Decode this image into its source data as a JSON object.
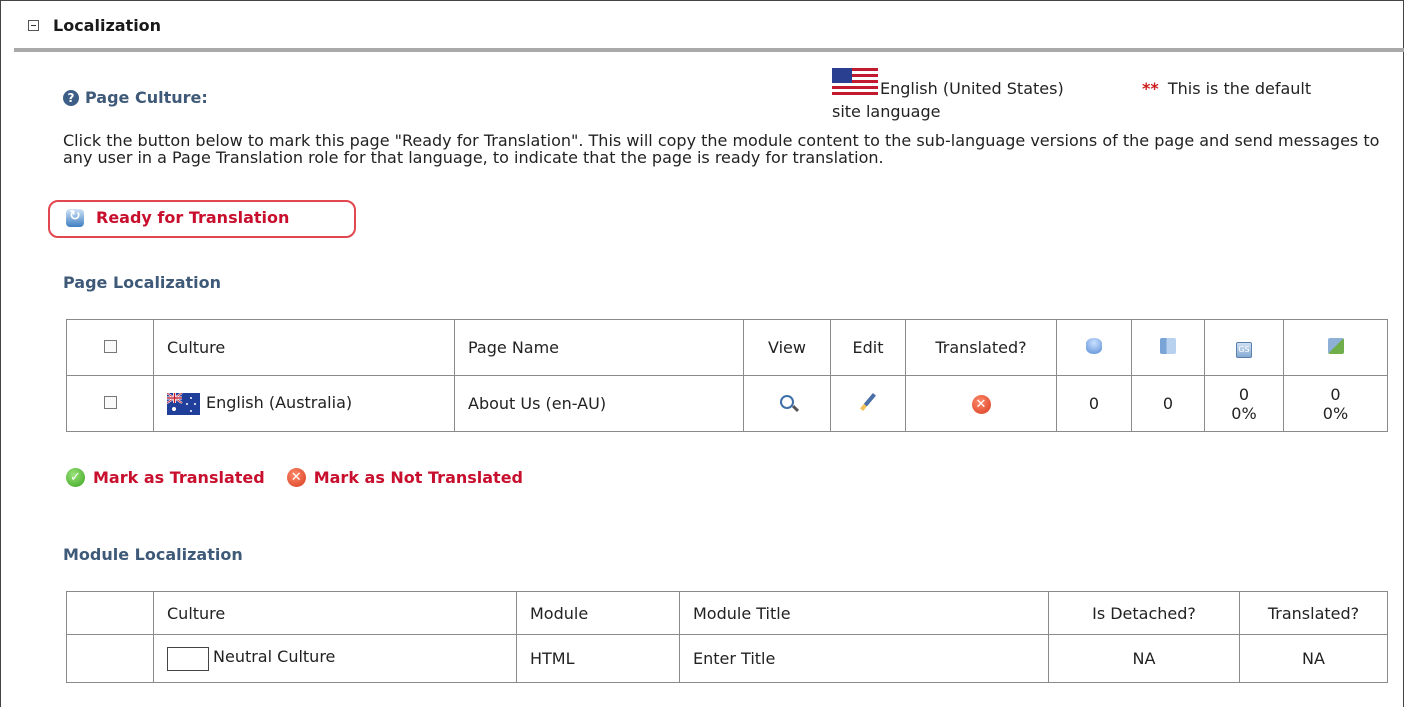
{
  "section": {
    "title": "Localization"
  },
  "page_culture": {
    "label": "Page Culture:",
    "language": "English (United States)",
    "default_note_stars": "**",
    "default_note": "This is the default",
    "default_note_cont": "site language"
  },
  "instructions": "Click the button below to mark this page \"Ready for Translation\". This will copy the module content to the sub-language versions of the page and send messages to any user in a Page Translation role for that language, to indicate that the page is ready for translation.",
  "ready_button": {
    "label": "Ready for Translation"
  },
  "page_localization": {
    "heading": "Page Localization",
    "columns": [
      "Culture",
      "Page Name",
      "View",
      "Edit",
      "Translated?"
    ],
    "icon_columns": [
      "database-icon",
      "documents-icon",
      "gs-icon",
      "translate-icon"
    ],
    "rows": [
      {
        "culture": "English (Australia)",
        "page_name": "About Us (en-AU)",
        "translated": false,
        "col1": "0",
        "col2": "0",
        "col3_count": "0",
        "col3_pct": "0%",
        "col4_count": "0",
        "col4_pct": "0%"
      }
    ]
  },
  "actions": {
    "mark_translated": "Mark as Translated",
    "mark_not_translated": "Mark as Not Translated"
  },
  "module_localization": {
    "heading": "Module Localization",
    "columns": [
      "Culture",
      "Module",
      "Module Title",
      "Is Detached?",
      "Translated?"
    ],
    "rows": [
      {
        "culture": "Neutral Culture",
        "module": "HTML",
        "module_title": "Enter Title",
        "is_detached": "NA",
        "translated": "NA"
      }
    ]
  },
  "colors": {
    "accent_red": "#c8102e",
    "heading_blue": "#3f5a78",
    "highlight_border": "#e0474f"
  }
}
